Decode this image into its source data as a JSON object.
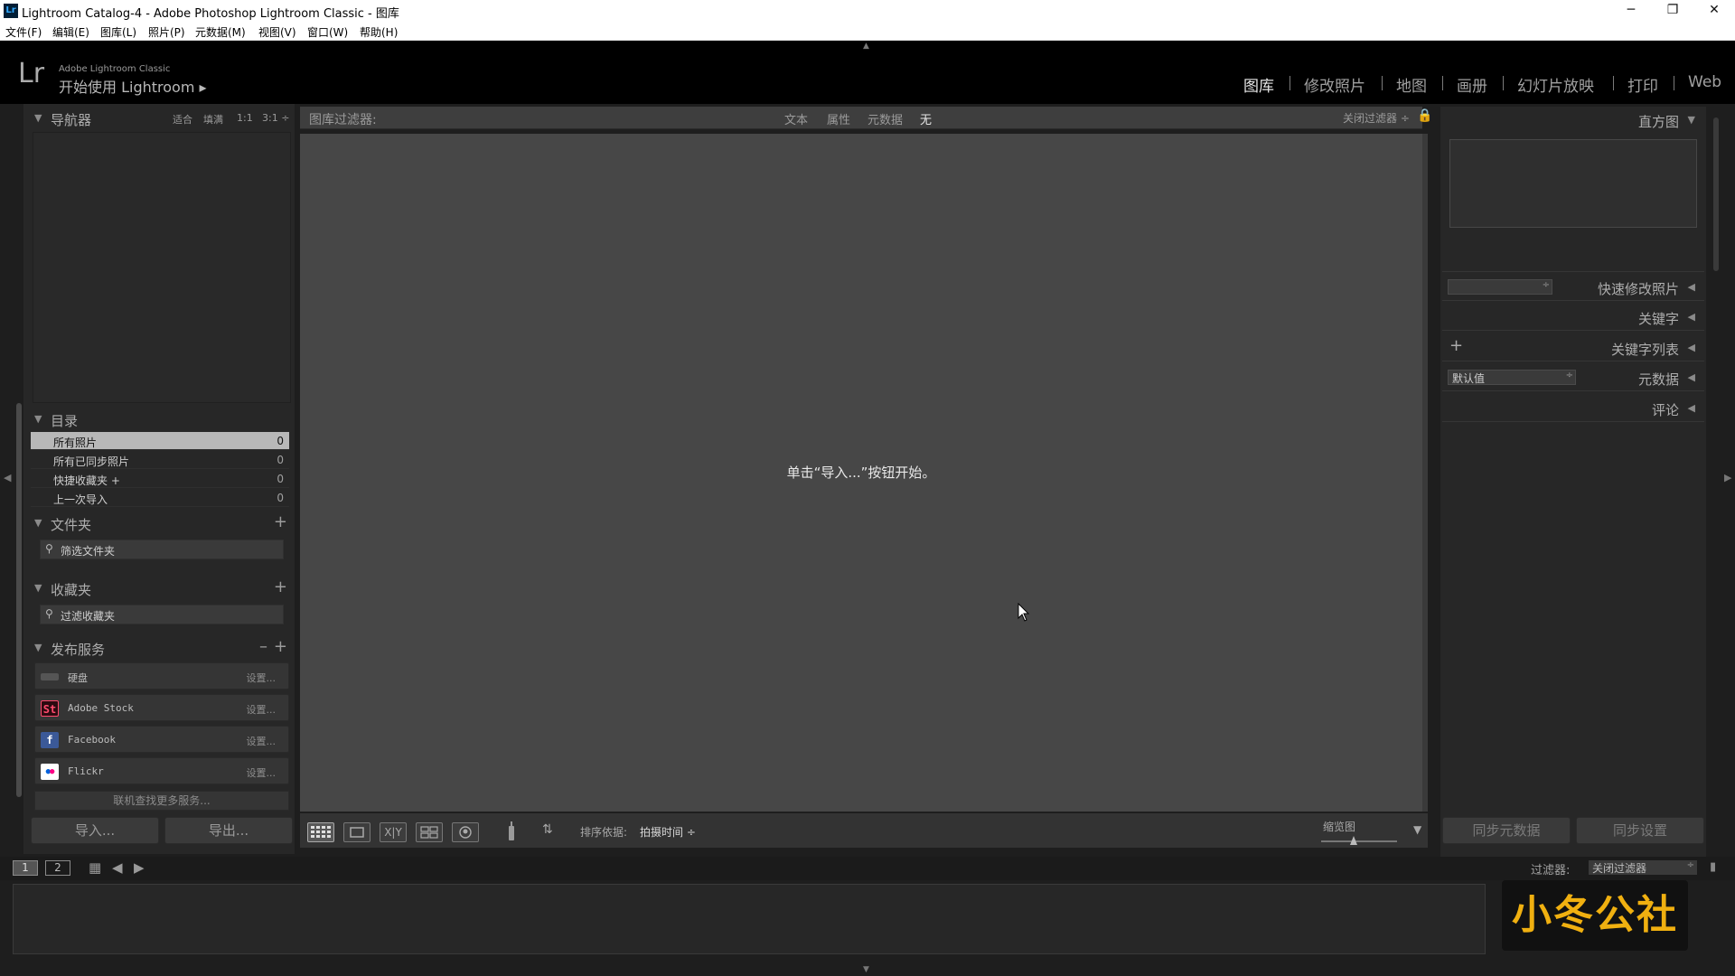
{
  "window": {
    "title": "Lightroom Catalog-4 - Adobe Photoshop Lightroom Classic - 图库",
    "icon": "Lr",
    "minimize": "─",
    "restore": "❐",
    "close": "✕"
  },
  "menu": [
    "文件(F)",
    "编辑(E)",
    "图库(L)",
    "照片(P)",
    "元数据(M)",
    "视图(V)",
    "窗口(W)",
    "帮助(H)"
  ],
  "identity": {
    "logo": "Lr",
    "brand": "Adobe Lightroom Classic",
    "start": "开始使用 Lightroom ▸"
  },
  "modules": [
    "图库",
    "修改照片",
    "地图",
    "画册",
    "幻灯片放映",
    "打印",
    "Web"
  ],
  "left": {
    "navigator": {
      "title": "导航器",
      "zoom": [
        "适合",
        "填满",
        "1:1",
        "3:1 ÷"
      ]
    },
    "catalog": {
      "title": "目录",
      "rows": [
        {
          "label": "所有照片",
          "count": "0"
        },
        {
          "label": "所有已同步照片",
          "count": "0"
        },
        {
          "label": "快捷收藏夹 +",
          "count": "0"
        },
        {
          "label": "上一次导入",
          "count": "0"
        }
      ]
    },
    "folders": {
      "title": "文件夹",
      "filter": "筛选文件夹"
    },
    "collections": {
      "title": "收藏夹",
      "filter": "过滤收藏夹"
    },
    "publish": {
      "title": "发布服务",
      "services": [
        {
          "name": "硬盘",
          "setup": "设置..."
        },
        {
          "name": "Adobe Stock",
          "logo": "St",
          "setup": "设置..."
        },
        {
          "name": "Facebook",
          "logo": "f",
          "setup": "设置..."
        },
        {
          "name": "Flickr",
          "logo": "●●",
          "setup": "设置..."
        }
      ],
      "more": "联机查找更多服务..."
    },
    "import_btn": "导入...",
    "export_btn": "导出..."
  },
  "filterbar": {
    "label": "图库过滤器:",
    "options": [
      "文本",
      "属性",
      "元数据",
      "无"
    ],
    "preset": "关闭过滤器 ÷"
  },
  "center": {
    "message": "单击“导入...”按钮开始。"
  },
  "toolbar": {
    "sort_label": "排序依据:",
    "sort_value": "拍摄时间 ÷",
    "thumb_label": "缩览图"
  },
  "right": {
    "histogram": "直方图",
    "quick_develop": "快速修改照片",
    "keywording": "关键字",
    "keyword_list": "关键字列表",
    "metadata": "元数据",
    "metadata_preset": "默认值",
    "comments": "评论",
    "sync_meta": "同步元数据",
    "sync_settings": "同步设置"
  },
  "filmstrip": {
    "page1": "1",
    "page2": "2",
    "filter_label": "过滤器:",
    "filter_value": "关闭过滤器"
  },
  "watermark": "小冬公社",
  "colors": {
    "flickr_blue": "#0063dc",
    "flickr_pink": "#ff0084",
    "stock_bg": "#2b0a10",
    "stock_fg": "#ff4b6e",
    "fb": "#3b5998"
  }
}
